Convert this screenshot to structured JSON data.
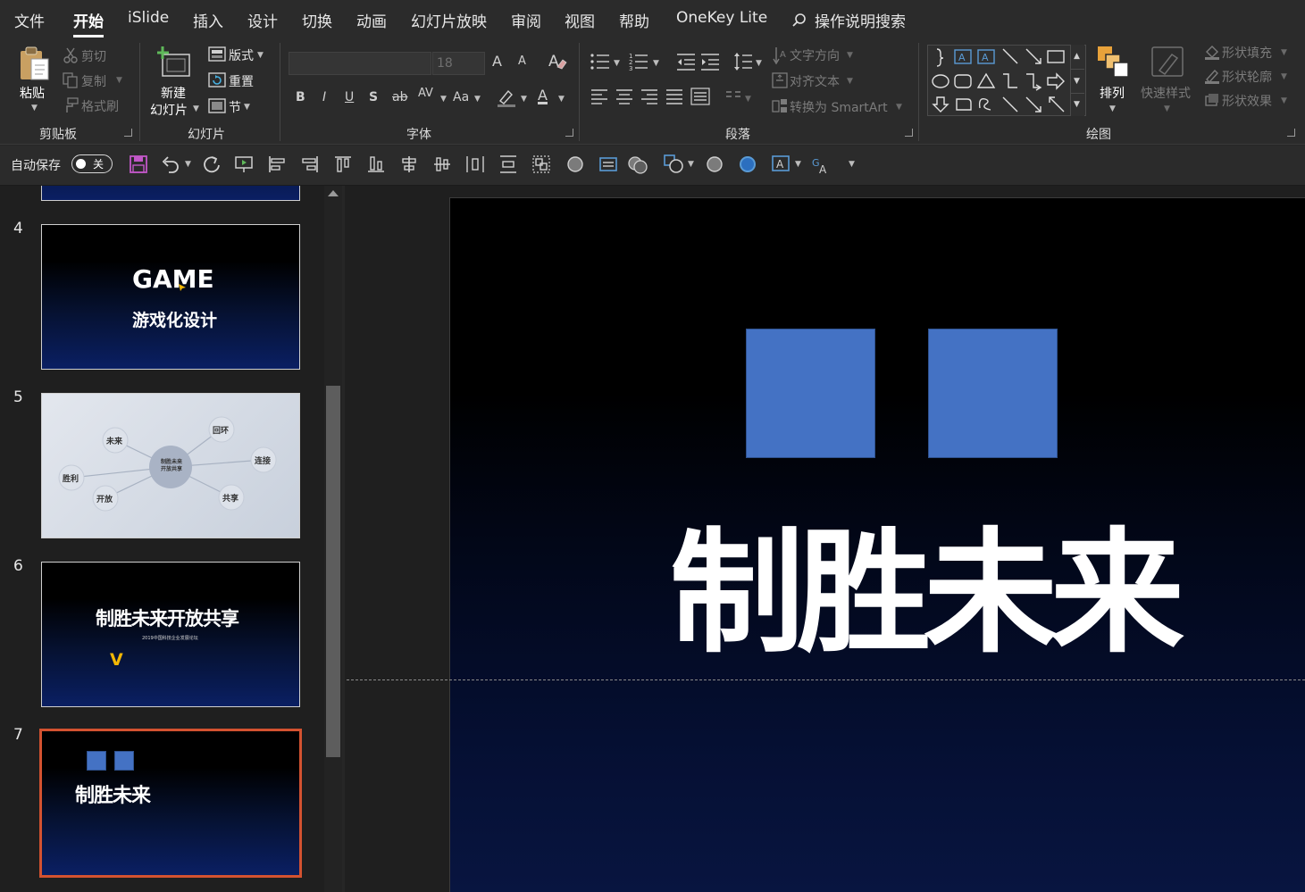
{
  "menu": {
    "tabs": [
      "文件",
      "开始",
      "iSlide",
      "插入",
      "设计",
      "切换",
      "动画",
      "幻灯片放映",
      "审阅",
      "视图",
      "帮助",
      "OneKey Lite"
    ],
    "active_tab": "开始",
    "search_label": "操作说明搜索"
  },
  "ribbon": {
    "clipboard": {
      "label": "剪贴板",
      "paste": "粘贴",
      "cut": "剪切",
      "copy": "复制",
      "format_painter": "格式刷"
    },
    "slides": {
      "label": "幻灯片",
      "new_slide_line1": "新建",
      "new_slide_line2": "幻灯片",
      "layout": "版式",
      "reset": "重置",
      "section": "节"
    },
    "font": {
      "label": "字体",
      "font_name": "",
      "font_size": "18",
      "bold": "B",
      "italic": "I",
      "underline": "U",
      "shadow": "S",
      "strike": "ab",
      "spacing": "AV",
      "case": "Aa",
      "grow": "A",
      "shrink": "A",
      "font_color": "A"
    },
    "paragraph": {
      "label": "段落",
      "text_direction": "文字方向",
      "align_text": "对齐文本",
      "smartart": "转换为 SmartArt"
    },
    "drawing": {
      "label": "绘图",
      "arrange": "排列",
      "quick_styles": "快速样式",
      "shape_fill": "形状填充",
      "shape_outline": "形状轮廓",
      "shape_effects": "形状效果"
    }
  },
  "qat": {
    "autosave_label": "自动保存",
    "autosave_state": "关"
  },
  "slides_panel": [
    {
      "number": "4",
      "title": "GAME",
      "subtitle": "游戏化设计"
    },
    {
      "number": "5",
      "center": "制胜未来\n开放共享",
      "nodes": [
        "未来",
        "回环",
        "连接",
        "胜利",
        "开放",
        "共享"
      ]
    },
    {
      "number": "6",
      "title": "制胜未来开放共享",
      "subtitle": "2019中国科技企业发展论坛",
      "mark": "V"
    },
    {
      "number": "7",
      "title": "制胜未来",
      "selected": true
    }
  ],
  "main_slide": {
    "title": "制胜未来",
    "square_color": "#4472c4"
  },
  "colors": {
    "selection": "#d35230",
    "accent_yellow": "#f2b705",
    "app_bg": "#2b2b2b"
  }
}
